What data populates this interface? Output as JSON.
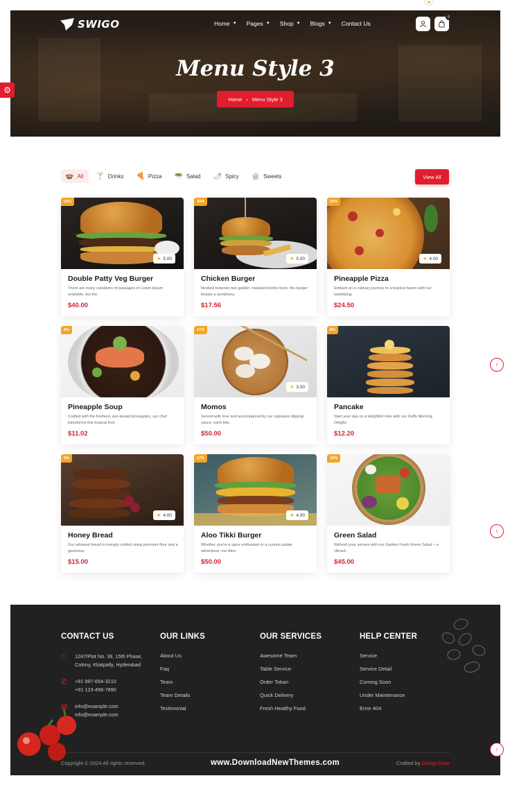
{
  "header": {
    "brand": "SWIGO",
    "nav": [
      {
        "label": "Home"
      },
      {
        "label": "Pages"
      },
      {
        "label": "Shop"
      },
      {
        "label": "Blogs"
      },
      {
        "label": "Contact Us"
      }
    ],
    "cart_count": "0",
    "page_title": "Menu Style 3",
    "breadcrumb": {
      "home": "Home",
      "current": "Menu Style 3"
    }
  },
  "filters": [
    {
      "label": "All",
      "icon": "all-food-icon"
    },
    {
      "label": "Drinks",
      "icon": "drink-icon"
    },
    {
      "label": "Pizza",
      "icon": "pizza-icon"
    },
    {
      "label": "Salad",
      "icon": "salad-icon"
    },
    {
      "label": "Spicy",
      "icon": "spicy-icon"
    },
    {
      "label": "Sweets",
      "icon": "cupcake-icon"
    }
  ],
  "view_all_label": "View All",
  "menu_items": [
    {
      "discount": "20%",
      "rating": "5.00",
      "name": "Double Patty Veg Burger",
      "description": "There are many variations of passages of Lorem Ipsum available, but the.",
      "price": "$40.00"
    },
    {
      "discount": "30%",
      "rating": "5.00",
      "name": "Chicken Burger",
      "description": "Nestled between two golden, toasted brioche buns, the burger boasts a symphony.",
      "price": "$17.56"
    },
    {
      "discount": "20%",
      "rating": "4.00",
      "name": "Pineapple Pizza",
      "description": "Embark on a culinary journey to a tropical haven with our tantalizing.",
      "price": "$24.50"
    },
    {
      "discount": "8%",
      "rating": "",
      "name": "Pineapple Soup",
      "description": "Crafted with the freshest, sun-kissed pineapples, our chef transforms this tropical fruit.",
      "price": "$11.02"
    },
    {
      "discount": "17%",
      "rating": "3.00",
      "name": "Momos",
      "description": "Served with love and accompanied by our signature dipping sauce, each bite.",
      "price": "$50.00"
    },
    {
      "discount": "8%",
      "rating": "",
      "name": "Pancake",
      "description": "Start your day on a delightful note with our Fluffy Morning Delight.",
      "price": "$12.20"
    },
    {
      "discount": "6%",
      "rating": "4.00",
      "name": "Honey Bread",
      "description": "Our artisanal bread is lovingly crafted using premium flour and a generous.",
      "price": "$15.00"
    },
    {
      "discount": "17%",
      "rating": "4.00",
      "name": "Aloo Tikki Burger",
      "description": "Whether you're a spice enthusiast or a curious palate adventurer, our Aloo.",
      "price": "$50.00"
    },
    {
      "discount": "10%",
      "rating": "",
      "name": "Green Salad",
      "description": "Refresh your senses with our Garden Fresh Green Salad – a vibrant.",
      "price": "$45.00"
    }
  ],
  "footer": {
    "contact": {
      "heading": "CONTACT US",
      "address": [
        "1247/Plot No. 39, 15th Phase,",
        "Colony, Kkatpally, Hyderabad"
      ],
      "phones": [
        "+91 987-654-3210",
        "+91 123-456-7890"
      ],
      "emails": [
        "info@example.com",
        "info@example.com"
      ]
    },
    "links": {
      "heading": "OUR LINKS",
      "items": [
        "About Us",
        "Faq",
        "Team",
        "Team Details",
        "Testimonial"
      ]
    },
    "services": {
      "heading": "OUR SERVICES",
      "items": [
        "Awesome Team",
        "Table Service",
        "Order Tokan",
        "Quick Delivery",
        "Fresh Healthy Food"
      ]
    },
    "help": {
      "heading": "HELP CENTER",
      "items": [
        "Service",
        "Service Detail",
        "Coming Soon",
        "Under Maintenance",
        "Error 404"
      ]
    },
    "copyright": "Copyright © 2024 All rights reserved.",
    "watermark": "www.DownloadNewThemes.com",
    "crafted_prefix": "Crafted by",
    "crafted_brand": "DexignZone"
  },
  "colors": {
    "accent": "#e11d2e",
    "badge": "#f5a524",
    "footer_bg": "#222121"
  }
}
